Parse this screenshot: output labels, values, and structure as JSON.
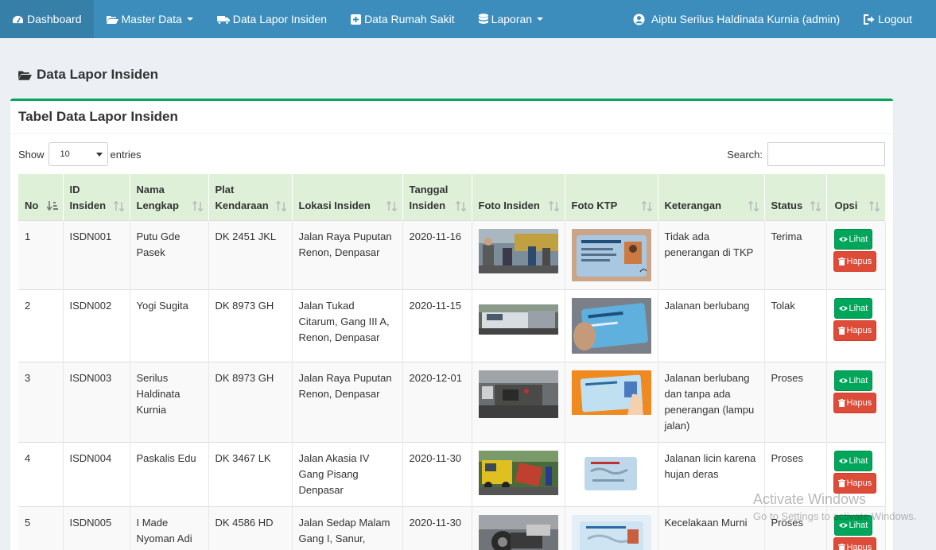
{
  "nav": {
    "dashboard": "Dashboard",
    "master_data": "Master Data",
    "data_lapor_insiden": "Data Lapor Insiden",
    "data_rumah_sakit": "Data Rumah Sakit",
    "laporan": "Laporan",
    "user": "Aiptu Serilus Haldinata Kurnia (admin)",
    "logout": "Logout"
  },
  "page": {
    "title": "Data Lapor Insiden"
  },
  "box": {
    "title": "Tabel Data Lapor Insiden"
  },
  "controls": {
    "show": "Show",
    "entries_value": "10",
    "entries": "entries",
    "search": "Search:"
  },
  "table": {
    "headers": {
      "no": "No",
      "id_line1": "ID",
      "id_line2": "Insiden",
      "nama_line1": "Nama",
      "nama_line2": "Lengkap",
      "plat_line1": "Plat",
      "plat_line2": "Kendaraan",
      "lokasi": "Lokasi Insiden",
      "tanggal_line1": "Tanggal",
      "tanggal_line2": "Insiden",
      "foto_insiden": "Foto Insiden",
      "foto_ktp": "Foto KTP",
      "keterangan": "Keterangan",
      "status": "Status",
      "opsi": "Opsi"
    },
    "rows": [
      {
        "no": "1",
        "id": "ISDN001",
        "nama": "Putu Gde Pasek",
        "plat": "DK 2451 JKL",
        "lokasi": "Jalan Raya Puputan Renon, Denpasar",
        "tanggal": "2020-11-16",
        "keterangan": "Tidak ada penerangan di TKP",
        "status": "Terima"
      },
      {
        "no": "2",
        "id": "ISDN002",
        "nama": "Yogi Sugita",
        "plat": "DK 8973 GH",
        "lokasi": "Jalan Tukad Citarum, Gang III A, Renon, Denpasar",
        "tanggal": "2020-11-15",
        "keterangan": "Jalanan berlubang",
        "status": "Tolak"
      },
      {
        "no": "3",
        "id": "ISDN003",
        "nama": "Serilus Haldinata Kurnia",
        "plat": "DK 8973 GH",
        "lokasi": "Jalan Raya Puputan Renon, Denpasar",
        "tanggal": "2020-12-01",
        "keterangan": "Jalanan berlubang dan tanpa ada penerangan (lampu jalan)",
        "status": "Proses"
      },
      {
        "no": "4",
        "id": "ISDN004",
        "nama": "Paskalis Edu",
        "plat": "DK 3467 LK",
        "lokasi": "Jalan Akasia IV Gang Pisang Denpasar",
        "tanggal": "2020-11-30",
        "keterangan": "Jalanan licin karena hujan deras",
        "status": "Proses"
      },
      {
        "no": "5",
        "id": "ISDN005",
        "nama": "I Made Nyoman Adi",
        "plat": "DK 4586 HD",
        "lokasi": "Jalan Sedap Malam Gang I, Sanur, Denpasar",
        "tanggal": "2020-11-30",
        "keterangan": "Kecelakaan Murni",
        "status": "Proses"
      }
    ],
    "btn_lihat": "Lihat",
    "btn_hapus": "Hapus"
  },
  "watermark": {
    "line1": "Activate Windows",
    "line2": "Go to Settings to activate Windows."
  },
  "colors": {
    "navbar": "#3c8dbc",
    "navbar_active": "#367fa9",
    "box_border": "#00a65a",
    "header_bg": "#dff0d8",
    "btn_lihat": "#00a65a",
    "btn_hapus": "#dd4b39"
  }
}
